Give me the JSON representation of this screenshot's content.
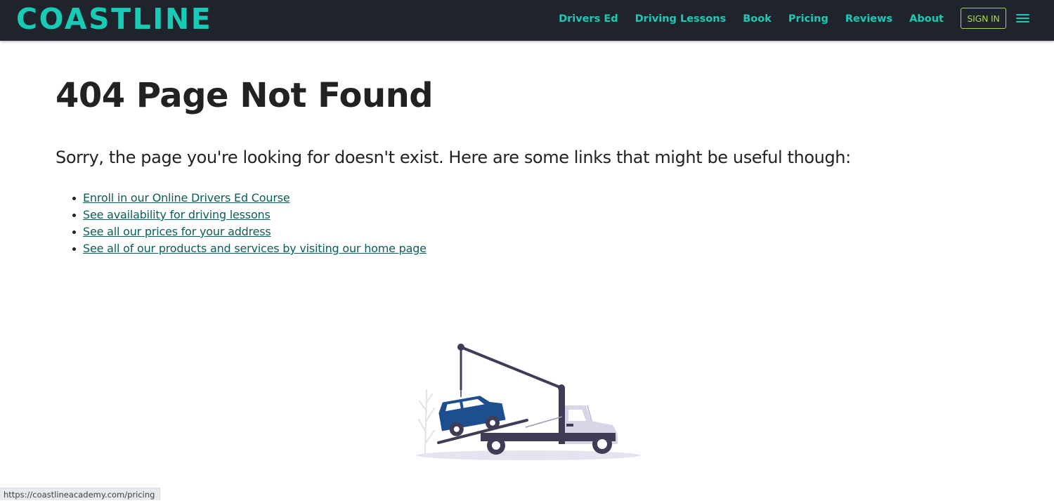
{
  "header": {
    "logo_text": "COASTLINE",
    "nav_links": [
      "Drivers Ed",
      "Driving Lessons",
      "Book",
      "Pricing",
      "Reviews",
      "About"
    ],
    "signin_label": "SIGN IN",
    "menu_icon": "hamburger-menu-icon"
  },
  "main": {
    "title": "404 Page Not Found",
    "message": "Sorry, the page you're looking for doesn't exist. Here are some links that might be useful though:",
    "links": [
      "Enroll in our Online Drivers Ed Course",
      "See availability for driving lessons",
      "See all our prices for your address",
      "See all of our products and services by visiting our home page"
    ],
    "illustration_icon": "tow-truck-illustration"
  },
  "statusbar": {
    "url": "https://coastlineacademy.com/pricing"
  },
  "colors": {
    "accent": "#17cbb7",
    "nav_bg": "#1f242c",
    "signin": "#a8d84a",
    "link": "#0b5f58",
    "text": "#222222",
    "car": "#1d4f8e",
    "truck_dark": "#3f3d56"
  }
}
